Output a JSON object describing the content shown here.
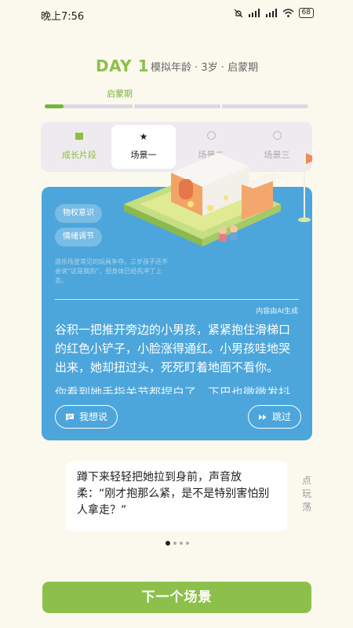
{
  "status_bar": {
    "time": "晚上7:56",
    "battery": "68"
  },
  "header": {
    "day": "DAY 1",
    "subtitle": "模拟年龄 · 3岁 · 启蒙期",
    "stage": "启蒙期",
    "progress": 0.07
  },
  "tabs": [
    {
      "label": "成长片段",
      "icon": "book-icon"
    },
    {
      "label": "场景一",
      "icon": "star-icon"
    },
    {
      "label": "场景二",
      "icon": "circle-icon"
    },
    {
      "label": "场景三",
      "icon": "circle-icon"
    }
  ],
  "story_card": {
    "tags": [
      "物权意识",
      "情绪调节"
    ],
    "faint_note": "游乐场里常见的玩具争夺。三岁孩子还不会说“这是我的”，但身体已经先冲了上去。",
    "ai_note": "内容由AI生成",
    "story_text": "谷积一把推开旁边的小男孩，紧紧抱住滑梯口的红色小铲子，小脸涨得通红。小男孩哇地哭出来，她却扭过头，死死盯着地面不看你。",
    "story_cut": "你看到她手指关节都捏白了，下巴也微微发抖",
    "speak_button": "我想说",
    "skip_button": "跳过"
  },
  "choice": {
    "text": "蹲下来轻轻把她拉到身前，声音放柔：“刚才抱那么紧，是不是特别害怕别人拿走？”"
  },
  "side_hint": "点玩荡",
  "next_button": "下一个场景",
  "colors": {
    "accent_green": "#8DC04A",
    "card_blue": "#4CA6DB",
    "background": "#FBF9EE"
  }
}
